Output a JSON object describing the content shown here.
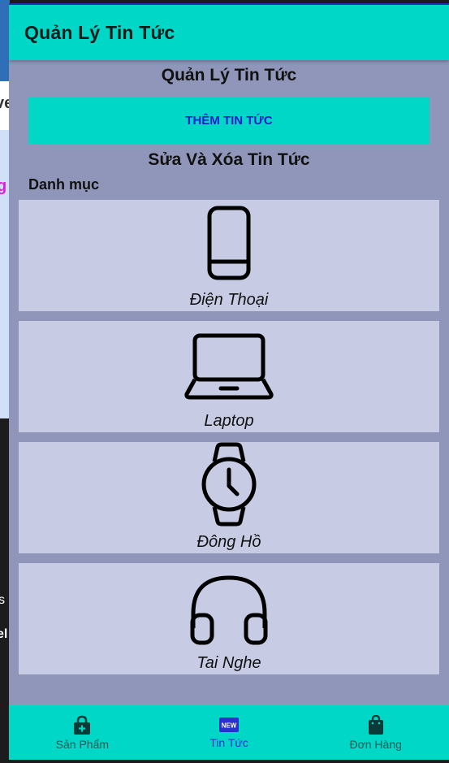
{
  "app_bar": {
    "title": "Quản Lý Tin Tức"
  },
  "header": {
    "title": "Quản Lý Tin Tức"
  },
  "add_button": {
    "label": "THÊM TIN TỨC"
  },
  "edit_section": {
    "title": "Sửa Và Xóa Tin Tức"
  },
  "categories": {
    "label": "Danh mục",
    "items": [
      {
        "label": "Điện Thoại",
        "icon": "phone-icon"
      },
      {
        "label": "Laptop",
        "icon": "laptop-icon"
      },
      {
        "label": "Đông Hồ",
        "icon": "watch-icon"
      },
      {
        "label": "Tai Nghe",
        "icon": "headphones-icon"
      }
    ]
  },
  "bottom_nav": {
    "items": [
      {
        "label": "Sản Phẩm",
        "icon": "lock-plus-icon"
      },
      {
        "label": "Tin Tức",
        "icon": "new-badge-icon",
        "active": true
      },
      {
        "label": "Đơn Hàng",
        "icon": "shopping-bag-icon"
      }
    ]
  },
  "background_app": {
    "fragment_1": "ve",
    "fragment_2": "g",
    "fragment_3": "s",
    "fragment_4": "el"
  },
  "colors": {
    "teal": "#00d7c6",
    "dialog_bg": "#8f96ba",
    "card_bg": "#c7cce4",
    "accent_text": "#1a1ad0"
  }
}
